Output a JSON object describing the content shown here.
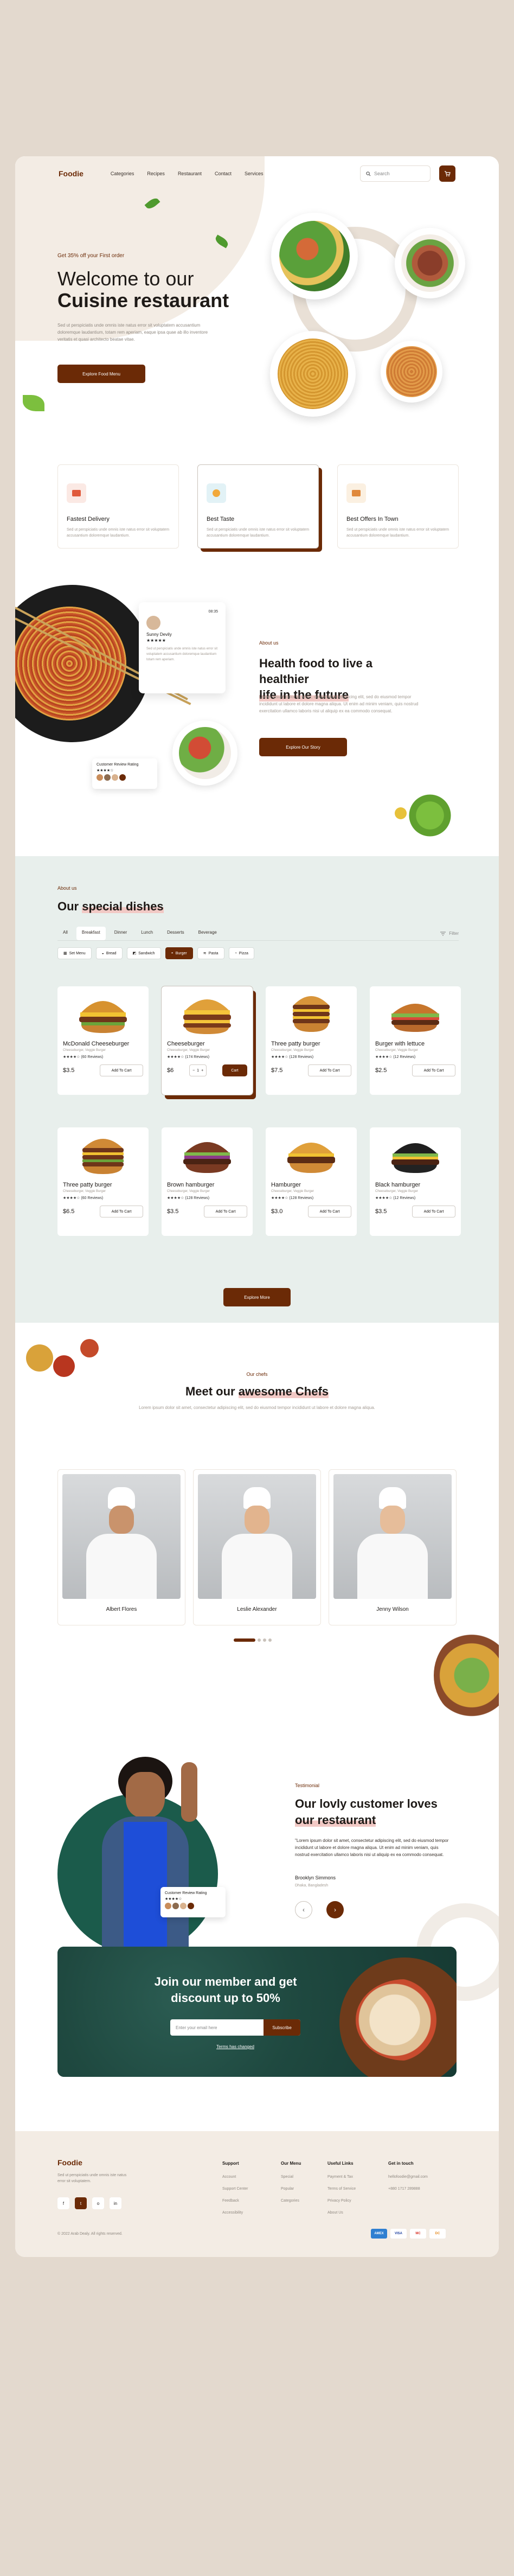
{
  "nav": {
    "logo": "Foodie",
    "links": [
      "Categories",
      "Recipes",
      "Restaurant",
      "Contact",
      "Services"
    ],
    "search_placeholder": "Search"
  },
  "hero": {
    "subtitle": "Get 35% off your First order",
    "title_line1": "Welcome to our",
    "title_line2": "Cuisine restaurant",
    "description": "Sed ut perspiciatis unde omnis iste natus error sit voluptatem accusantium doloremque laudantium, totam rem aperiam, eaque ipsa quae ab illo inventore veritatis et quasi architecto beatae vitae.",
    "button": "Explore Food Menu"
  },
  "features": [
    {
      "title": "Fastest Delivery",
      "text": "Sed ut perspiciatis unde omnis iste natus error sit voluptatem accusantium doloremque laudantium.",
      "icon": "delivery-icon"
    },
    {
      "title": "Best Taste",
      "text": "Sed ut perspiciatis unde omnis iste natus error sit voluptatem accusantium doloremque laudantium.",
      "icon": "taste-icon"
    },
    {
      "title": "Best Offers In Town",
      "text": "Sed ut perspiciatis unde omnis iste natus error sit voluptatem accusantium doloremque laudantium.",
      "icon": "offer-icon"
    }
  ],
  "about": {
    "chef_card_time": "08:35",
    "chef_card_name": "Sunny Devily",
    "chef_card_stars": "★★★★★",
    "chef_card_text": "Sed ut perspiciatis unde omnis iste natus error sit voluptatem accusantium doloremque laudantium totam rem aperiam.",
    "review_title": "Customer Review Rating",
    "review_stars": "★★★★☆",
    "label": "About us",
    "title_line1": "Health food to live a healthier",
    "title_line2": "life in the future",
    "description": "Lorem ipsum dolor sit amet, consectetur adipiscing elit, sed do eiusmod tempor incididunt ut labore et dolore magna aliqua. Ut enim ad minim veniam, quis nostrud exercitation ullamco laboris nisi ut aliquip ex ea commodo consequat.",
    "button": "Explore Our Story"
  },
  "dishes": {
    "label": "About us",
    "title_plain": "Our",
    "title_hl": "special dishes",
    "tabs": [
      "All",
      "Breakfast",
      "Dinner",
      "Lunch",
      "Desserts",
      "Beverage"
    ],
    "filter": "Filter",
    "chips": [
      "Set Menu",
      "Bread",
      "Sandwich",
      "Burger",
      "Pasta",
      "Pizza"
    ],
    "items": [
      {
        "name": "McDonald Cheeseburger",
        "sub": "Cheeseburger, Veggie Burger",
        "rating": "★★★★☆ (60 Reviews)",
        "price": "$3.5",
        "button": "Add To Cart"
      },
      {
        "name": "Cheeseburger",
        "sub": "Cheeseburger, Veggie Burger",
        "rating": "★★★★☆ (174 Reviews)",
        "price": "$6",
        "qty": "1",
        "button": "Cart"
      },
      {
        "name": "Three patty burger",
        "sub": "Cheeseburger, Veggie Burger",
        "rating": "★★★★☆ (128 Reviews)",
        "price": "$7.5",
        "button": "Add To Cart"
      },
      {
        "name": "Burger with lettuce",
        "sub": "Cheeseburger, Veggie Burger",
        "rating": "★★★★☆ (12 Reviews)",
        "price": "$2.5",
        "button": "Add To Cart"
      },
      {
        "name": "Three patty burger",
        "sub": "Cheeseburger, Veggie Burger",
        "rating": "★★★★☆ (60 Reviews)",
        "price": "$6.5",
        "button": "Add To Cart"
      },
      {
        "name": "Brown hamburger",
        "sub": "Cheeseburger, Veggie Burger",
        "rating": "★★★★☆ (128 Reviews)",
        "price": "$3.5",
        "button": "Add To Cart"
      },
      {
        "name": "Hamburger",
        "sub": "Cheeseburger, Veggie Burger",
        "rating": "★★★★☆ (128 Reviews)",
        "price": "$3.0",
        "button": "Add To Cart"
      },
      {
        "name": "Black hamburger",
        "sub": "Cheeseburger, Veggie Burger",
        "rating": "★★★★☆ (12 Reviews)",
        "price": "$3.5",
        "button": "Add To Cart"
      }
    ],
    "explore": "Explore More"
  },
  "chefs": {
    "label": "Our chefs",
    "title_plain": "Meet our",
    "title_hl": "awesome Chefs",
    "description": "Lorem ipsum dolor sit amet, consectetur adipiscing elit, sed do eiusmod tempor incididunt ut labore et dolore magna aliqua.",
    "names": [
      "Albert Flores",
      "Leslie Alexander",
      "Jenny Wilson"
    ]
  },
  "testimonial": {
    "label": "Testimonial",
    "title_line1": "Our lovly customer loves",
    "title_line2": "our restaurant",
    "quote": "\"Lorem ipsum dolor sit amet, consectetur adipiscing elit, sed do eiusmod tempor incididunt ut labore et dolore magna aliqua. Ut enim ad minim veniam, quis nostrud exercitation ullamco laboris nisi ut aliquip ex ea commodo consequat.",
    "name": "Brooklyn Simmons",
    "place": "Dhaka, Bangladesh",
    "review_title": "Customer Review Rating",
    "review_stars": "★★★★☆"
  },
  "newsletter": {
    "title": "Join our member and get discount up to 50%",
    "placeholder": "Enter your email here",
    "button": "Subscribe",
    "terms": "Terms has changed"
  },
  "footer": {
    "logo": "Foodie",
    "description": "Sed ut perspiciatis unde omnis iste natus error sit voluptatem.",
    "socials": [
      "f",
      "t",
      "o",
      "in"
    ],
    "columns": [
      {
        "title": "Support",
        "items": [
          "Account",
          "Support Center",
          "Feedback",
          "Accessibility"
        ]
      },
      {
        "title": "Our Menu",
        "items": [
          "Special",
          "Popular",
          "Categories"
        ]
      },
      {
        "title": "Useful Links",
        "items": [
          "Payment & Tax",
          "Terms of Service",
          "Privacy Policy",
          "About Us"
        ]
      },
      {
        "title": "Get in touch",
        "items": [
          "hellofoodie@gmail.com",
          "+880 1717 289888"
        ]
      }
    ],
    "copyright": "© 2022 Arab Dealy. All rights reserved.",
    "payments": [
      "AMEX",
      "VISA",
      "MC",
      "DC"
    ]
  },
  "colors": {
    "brand": "#6b2a06",
    "accent_highlight": "#f2c9c5",
    "dishes_bg": "#e8efec",
    "newsletter_bg": "#1f4940",
    "page_bg": "#e3d9ce"
  }
}
